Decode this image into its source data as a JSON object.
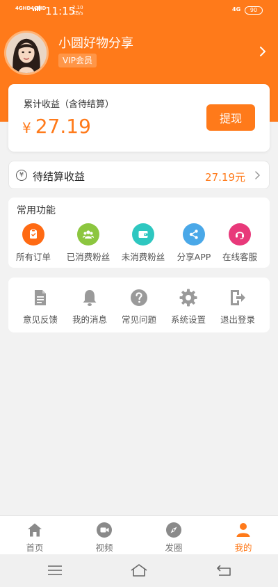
{
  "status_bar": {
    "sim1": "4G",
    "sim1_sub": "HD",
    "sim2": "4G",
    "sim2_sub": "HD",
    "time": "11:15",
    "speed_value": "2.10",
    "speed_unit": "KB/s",
    "network": "4G",
    "battery": "90"
  },
  "profile": {
    "name": "小圆好物分享",
    "badge": "VIP会员"
  },
  "earnings": {
    "label": "累计收益（含待结算）",
    "currency": "¥",
    "amount": "27.19",
    "withdraw_label": "提现"
  },
  "pending": {
    "icon_char": "¥",
    "label": "待结算收益",
    "value": "27.19元"
  },
  "functions": {
    "title": "常用功能",
    "items": [
      {
        "label": "所有订单",
        "color": "#ff6a13",
        "icon": "orders-icon"
      },
      {
        "label": "已消费粉丝",
        "color": "#8cc63f",
        "icon": "fans-consumed-icon"
      },
      {
        "label": "未消费粉丝",
        "color": "#2ec7c0",
        "icon": "wallet-icon"
      },
      {
        "label": "分享APP",
        "color": "#4aa8e8",
        "icon": "share-icon"
      },
      {
        "label": "在线客服",
        "color": "#e8397a",
        "icon": "headset-icon"
      }
    ]
  },
  "settings": {
    "items": [
      {
        "label": "意见反馈",
        "icon": "feedback-icon"
      },
      {
        "label": "我的消息",
        "icon": "bell-icon"
      },
      {
        "label": "常见问题",
        "icon": "question-icon"
      },
      {
        "label": "系统设置",
        "icon": "gear-icon"
      },
      {
        "label": "退出登录",
        "icon": "logout-icon"
      }
    ]
  },
  "tabs": [
    {
      "label": "首页",
      "icon": "home-icon",
      "active": false
    },
    {
      "label": "视频",
      "icon": "video-icon",
      "active": false
    },
    {
      "label": "发圈",
      "icon": "compass-icon",
      "active": false
    },
    {
      "label": "我的",
      "icon": "user-icon",
      "active": true
    }
  ],
  "colors": {
    "brand": "#ff7a1a",
    "icon_gray": "#9a9a9a"
  }
}
